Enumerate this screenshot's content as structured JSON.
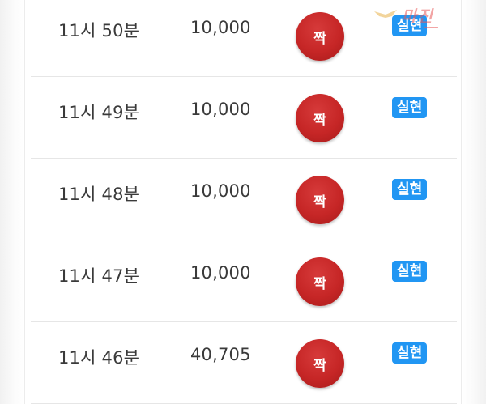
{
  "rows": [
    {
      "time": "11시 50분",
      "amount": "10,000",
      "result": "짝",
      "tag": "실현"
    },
    {
      "time": "11시 49분",
      "amount": "10,000",
      "result": "짝",
      "tag": "실현"
    },
    {
      "time": "11시 48분",
      "amount": "10,000",
      "result": "짝",
      "tag": "실현"
    },
    {
      "time": "11시 47분",
      "amount": "10,000",
      "result": "짝",
      "tag": "실현"
    },
    {
      "time": "11시 46분",
      "amount": "40,705",
      "result": "짝",
      "tag": "실현"
    }
  ],
  "watermark": {
    "text": "마진"
  },
  "colors": {
    "result_ball": "#c62626",
    "tag": "#2196f3",
    "text": "#3a3a3a",
    "divider": "#e6e6e6"
  }
}
